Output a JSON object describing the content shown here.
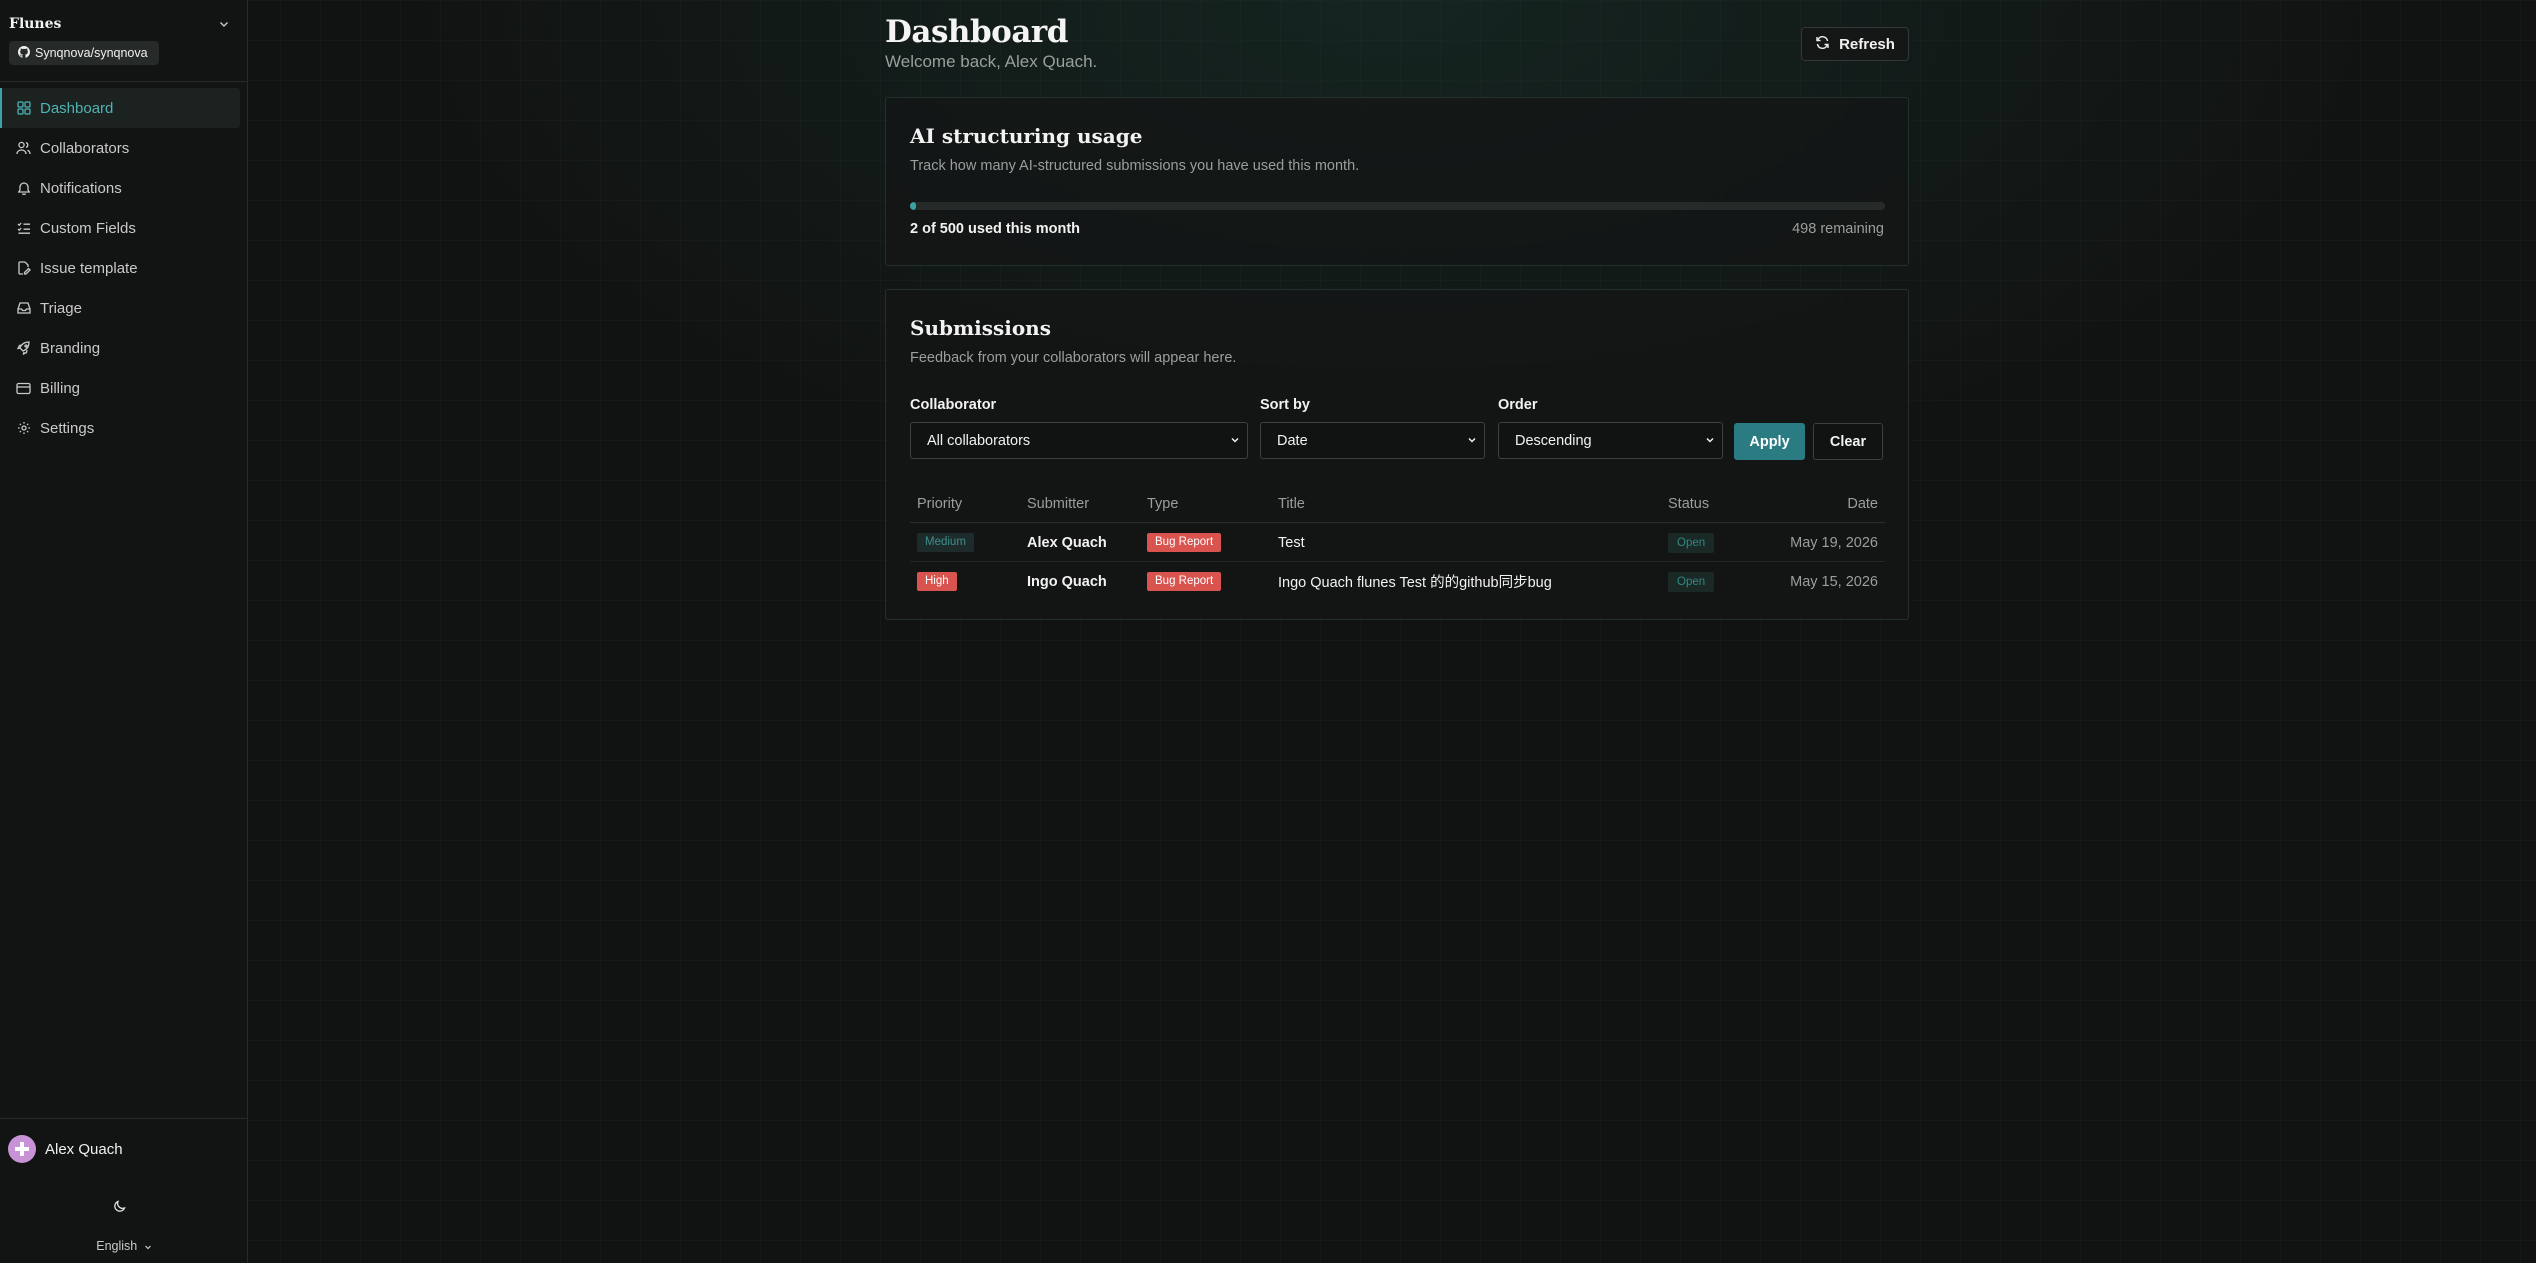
{
  "colors": {
    "accent": "#3aa3a3",
    "apply_button": "#2b7c82",
    "high_priority": "#d9534f",
    "bug_report": "#d9534f",
    "background": "#111312"
  },
  "sidebar": {
    "brand": "Flunes",
    "repo": "Synqnova/synqnova",
    "items": [
      {
        "label": "Dashboard",
        "icon": "grid-icon"
      },
      {
        "label": "Collaborators",
        "icon": "users-icon"
      },
      {
        "label": "Notifications",
        "icon": "bell-icon"
      },
      {
        "label": "Custom Fields",
        "icon": "list-checks-icon"
      },
      {
        "label": "Issue template",
        "icon": "file-edit-icon"
      },
      {
        "label": "Triage",
        "icon": "inbox-icon"
      },
      {
        "label": "Branding",
        "icon": "rocket-icon"
      },
      {
        "label": "Billing",
        "icon": "credit-card-icon"
      },
      {
        "label": "Settings",
        "icon": "gear-icon"
      }
    ],
    "active_item": "Dashboard",
    "user_name": "Alex Quach",
    "language": "English"
  },
  "header": {
    "title": "Dashboard",
    "welcome": "Welcome back, Alex Quach.",
    "refresh_label": "Refresh"
  },
  "usage": {
    "title": "AI structuring usage",
    "description": "Track how many AI-structured submissions you have used this month.",
    "used": 2,
    "limit": 500,
    "used_text": "2 of 500 used this month",
    "remaining_text": "498 remaining"
  },
  "submissions": {
    "title": "Submissions",
    "description": "Feedback from your collaborators will appear here.",
    "filters": {
      "collaborator_label": "Collaborator",
      "collaborator_value": "All collaborators",
      "sort_label": "Sort by",
      "sort_value": "Date",
      "order_label": "Order",
      "order_value": "Descending",
      "apply_label": "Apply",
      "clear_label": "Clear"
    },
    "columns": [
      "Priority",
      "Submitter",
      "Type",
      "Title",
      "Status",
      "Date"
    ],
    "rows": [
      {
        "priority": "Medium",
        "submitter": "Alex Quach",
        "type": "Bug Report",
        "title": "Test",
        "status": "Open",
        "date": "May 19, 2026"
      },
      {
        "priority": "High",
        "submitter": "Ingo Quach",
        "type": "Bug Report",
        "title": "Ingo Quach flunes Test 的的github同步bug",
        "status": "Open",
        "date": "May 15, 2026"
      }
    ]
  }
}
